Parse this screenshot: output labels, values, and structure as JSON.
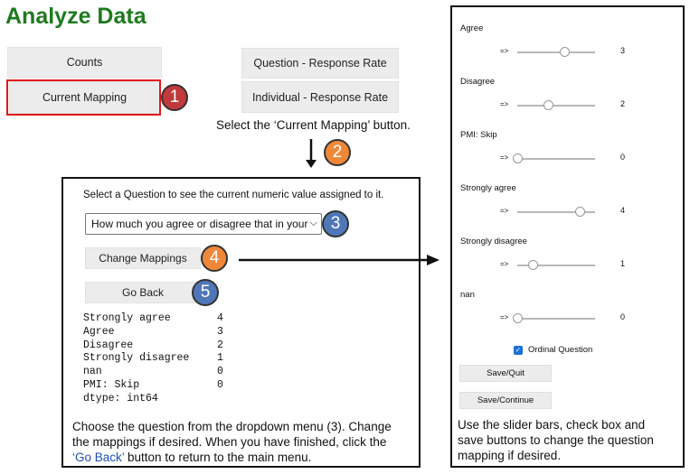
{
  "title": "Analyze Data",
  "buttons": {
    "counts": "Counts",
    "current_mapping": "Current Mapping",
    "question_response_rate": "Question - Response Rate",
    "individual_response_rate": "Individual - Response Rate"
  },
  "steps": {
    "one": "1",
    "two": "2",
    "three": "3",
    "four": "4",
    "five": "5"
  },
  "step_colors": {
    "red": "#c0393b",
    "orange": "#ee8838",
    "blue": "#4f77b8"
  },
  "captions": {
    "select_current_mapping": "Select the ‘Current Mapping’ button.",
    "middle_line1": "Choose the question from the dropdown menu (3). Change",
    "middle_line2": "the mappings if desired. When you have finished, click the",
    "middle_go_back": "‘Go Back’",
    "middle_line3_rest": " button to return to the main menu.",
    "right_line1": "Use the slider bars, check box and",
    "right_line2": "save buttons to change the question",
    "right_line3": "mapping if desired."
  },
  "mapping_panel": {
    "prompt": "Select a Question to see the current numeric value assigned to it.",
    "dropdown_value": "How much you agree or disagree that in your n",
    "change_mappings": "Change Mappings",
    "go_back": "Go Back",
    "output": [
      {
        "key": "Strongly agree",
        "value": "4"
      },
      {
        "key": "Agree",
        "value": "3"
      },
      {
        "key": "Disagree",
        "value": "2"
      },
      {
        "key": "Strongly disagree",
        "value": "1"
      },
      {
        "key": "nan",
        "value": "0"
      },
      {
        "key": "PMI: Skip",
        "value": "0"
      }
    ],
    "dtype": "dtype: int64"
  },
  "slider_panel": {
    "arrow": "=>",
    "sliders": [
      {
        "label": "Agree",
        "value": "3",
        "level": 0.6
      },
      {
        "label": "Disagree",
        "value": "2",
        "level": 0.4
      },
      {
        "label": "PMI: Skip",
        "value": "0",
        "level": 0.0
      },
      {
        "label": "Strongly agree",
        "value": "4",
        "level": 0.8
      },
      {
        "label": "Strongly disagree",
        "value": "1",
        "level": 0.2
      },
      {
        "label": "nan",
        "value": "0",
        "level": 0.0
      }
    ],
    "ordinal_label": "Ordinal Question",
    "ordinal_checked": true,
    "save_quit": "Save/Quit",
    "save_continue": "Save/Continue",
    "checkbox_color": "#1a6fd6"
  },
  "title_color": "#1e7a1e",
  "highlight_color": "#e01818"
}
